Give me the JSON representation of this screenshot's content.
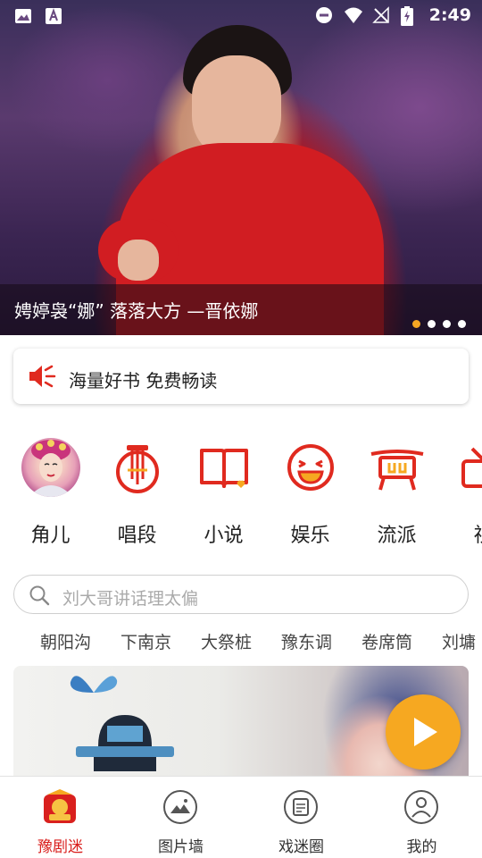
{
  "status_bar": {
    "time": "2:49",
    "left_icons": [
      "image-icon",
      "app-a-icon"
    ],
    "right_icons": [
      "do-not-disturb-icon",
      "wifi-icon",
      "no-signal-icon",
      "battery-icon"
    ]
  },
  "banner": {
    "caption": "娉婷袅“娜” 落落大方 —晋依娜",
    "slide_count": 4,
    "active_slide": 1
  },
  "notice": {
    "icon": "speaker-icon",
    "text": "海量好书 免费畅读"
  },
  "categories": [
    {
      "label": "角儿",
      "icon": "avatar-image"
    },
    {
      "label": "唱段",
      "icon": "lyre-icon"
    },
    {
      "label": "小说",
      "icon": "book-icon"
    },
    {
      "label": "娱乐",
      "icon": "laughing-face-icon"
    },
    {
      "label": "流派",
      "icon": "drum-icon"
    },
    {
      "label": "视",
      "icon": "video-icon"
    }
  ],
  "search": {
    "placeholder": "刘大哥讲话理太偏"
  },
  "tags": [
    "朝阳沟",
    "下南京",
    "大祭桩",
    "豫东调",
    "卷席筒",
    "刘墉"
  ],
  "bottom_nav": [
    {
      "label": "豫剧迷",
      "icon": "home-logo-icon",
      "active": true
    },
    {
      "label": "图片墙",
      "icon": "picture-icon",
      "active": false
    },
    {
      "label": "戏迷圈",
      "icon": "chat-circle-icon",
      "active": false
    },
    {
      "label": "我的",
      "icon": "user-icon",
      "active": false
    }
  ],
  "colors": {
    "accent_red": "#d9201e",
    "accent_orange": "#f6a821",
    "text": "#222222",
    "placeholder": "#aaaaaa"
  }
}
